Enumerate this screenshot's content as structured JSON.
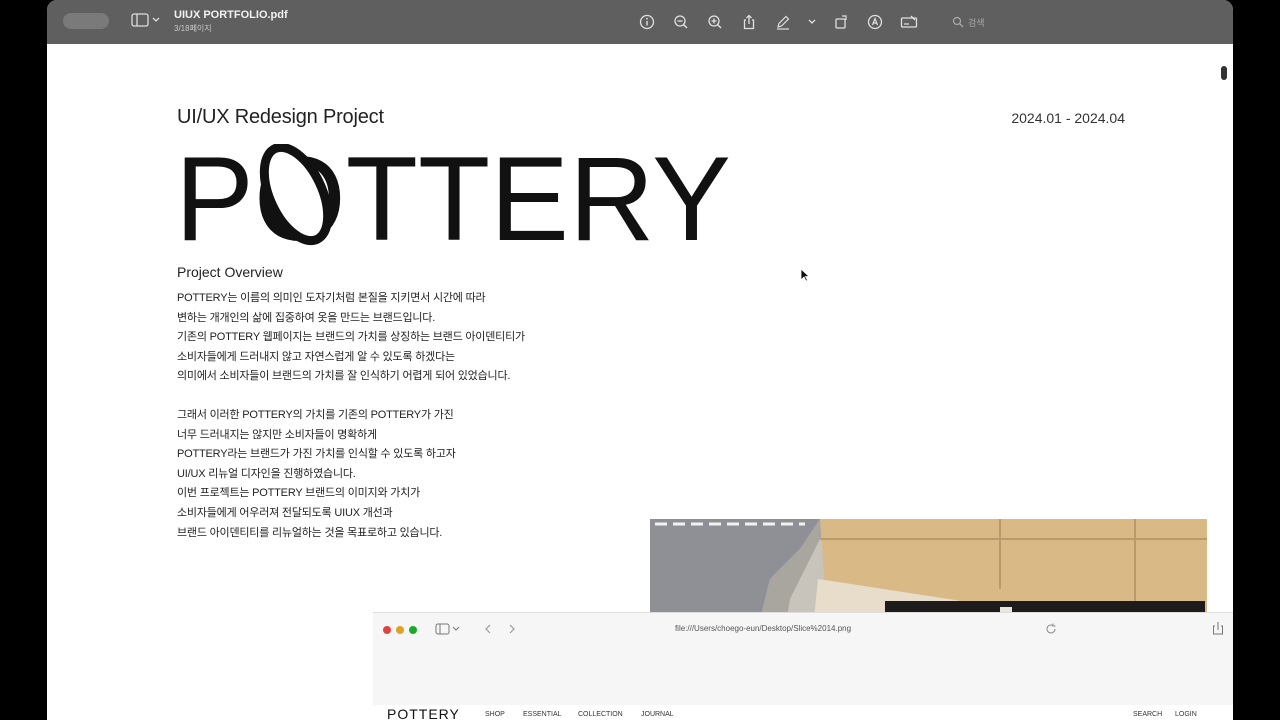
{
  "app": {
    "doc_title": "UIUX PORTFOLIO.pdf",
    "page_info": "3/18페이지",
    "search_placeholder": "검색"
  },
  "page": {
    "subtitle": "UI/UX Redesign Project",
    "date": "2024.01 - 2024.04",
    "logo_text": "POTTERY",
    "overview_heading": "Project Overview",
    "paragraph1": [
      "POTTERY는 이름의 의미인 도자기처럼 본질을 지키면서 시간에 따라",
      "변하는 개개인의 삶에 집중하여 옷을 만드는 브랜드입니다.",
      "기존의 POTTERY 웹페이지는 브랜드의 가치를 상징하는 브랜드 아이덴티티가",
      "소비자들에게 드러내지 않고 자연스럽게 알 수 있도록 하겠다는",
      "의미에서 소비자들이 브랜드의 가치를 잘 인식하기 어렵게 되어 있었습니다."
    ],
    "paragraph2": [
      "그래서 이러한 POTTERY의 가치를 기존의 POTTERY가 가진",
      "너무 드러내지는 않지만 소비자들이 명확하게",
      "POTTERY라는 브랜드가 가진 가치를 인식할 수 있도록 하고자",
      "UI/UX 리뉴얼 디자인을 진행하였습니다.",
      "이번 프로젝트는 POTTERY 브랜드의 이미지와 가치가",
      "소비자들에게 어우러져 전달되도록 UIUX 개선과",
      "브랜드 아이덴티티를 리뉴얼하는 것을 목표로하고 있습니다."
    ]
  },
  "safari": {
    "url": "file:///Users/choego-eun/Desktop/Slice%2014.png",
    "logo": "POTTERY",
    "menu": [
      "SHOP",
      "ESSENTIAL",
      "COLLECTION",
      "JOURNAL"
    ],
    "right_menu": [
      "SEARCH",
      "LOGIN"
    ]
  },
  "colors": {
    "titlebar": "#5f5f5f",
    "page_bg": "#ffffff",
    "text": "#222222"
  }
}
